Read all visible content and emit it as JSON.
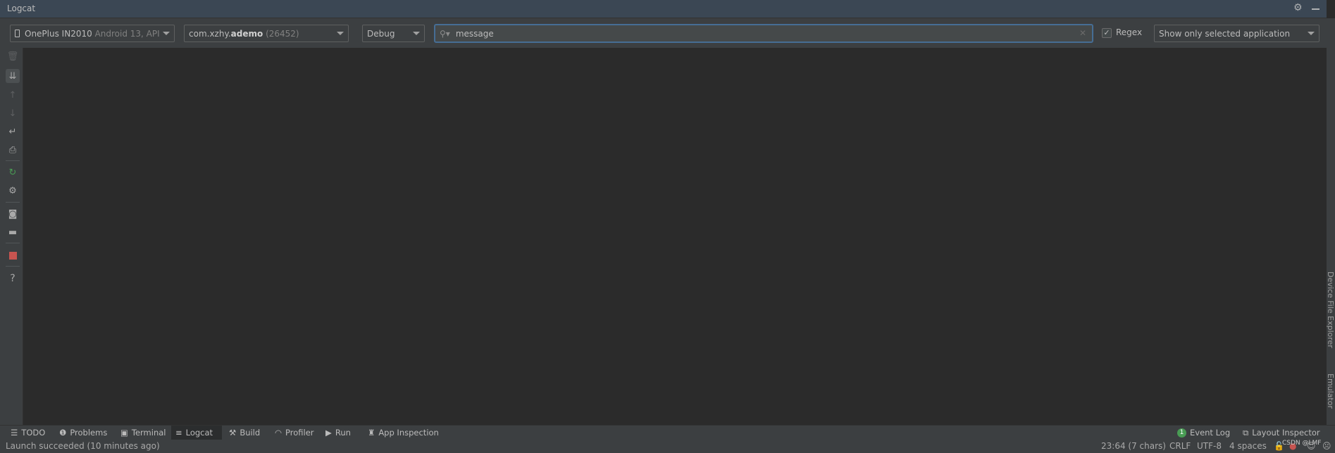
{
  "window": {
    "title": "Logcat",
    "icons": [
      "gear-icon",
      "minimize-icon"
    ]
  },
  "toolbar": {
    "device": {
      "name": "OnePlus IN2010",
      "detail": "Android 13, API",
      "icon": "phone-icon"
    },
    "process": {
      "package_prefix": "com.xzhy.",
      "package_bold": "ademo",
      "pid": "(26452)"
    },
    "log_level": "Debug",
    "search": {
      "value": "message",
      "icon": "search-icon"
    },
    "regex": {
      "label": "Regex",
      "checked": true
    },
    "filter": "Show only selected application"
  },
  "left_toolbar": [
    "trash-icon",
    "scroll-to-end-icon",
    "arrow-up-icon",
    "arrow-down-icon",
    "soft-wrap-icon",
    "print-icon",
    "restart-icon",
    "settings-icon",
    "screenshot-icon",
    "screen-record-icon",
    "stop-icon",
    "help-icon"
  ],
  "right_sidebar": {
    "items": [
      "Device File Explorer",
      "Emulator"
    ]
  },
  "bottom_tabs": {
    "left": [
      {
        "label": "TODO"
      },
      {
        "label": "Problems"
      },
      {
        "label": "Terminal"
      },
      {
        "label": "Logcat",
        "active": true
      },
      {
        "label": "Build"
      },
      {
        "label": "Profiler"
      },
      {
        "label": "Run"
      },
      {
        "label": "App Inspection"
      }
    ],
    "right": [
      {
        "label": "Event Log",
        "badge": "1"
      },
      {
        "label": "Layout Inspector"
      }
    ]
  },
  "status": {
    "message": "Launch succeeded (10 minutes ago)",
    "position": "23:64 (7 chars)",
    "line_sep": "CRLF",
    "encoding": "UTF-8",
    "indent": "4 spaces",
    "watermark": "CSDN @LMF"
  },
  "colors": {
    "accent": "#466d94",
    "success": "#499c54",
    "error": "#c75450"
  }
}
